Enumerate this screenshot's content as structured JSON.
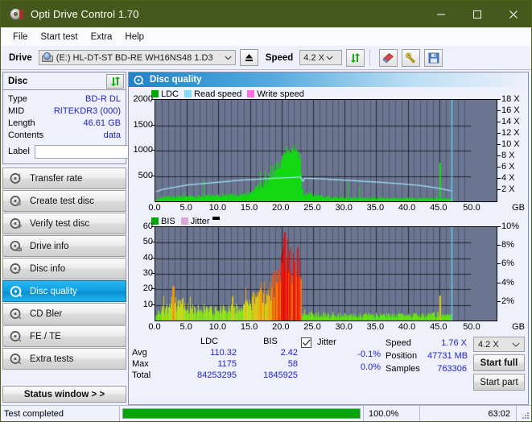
{
  "window": {
    "title": "Opti Drive Control 1.70",
    "icon": "disc-icon",
    "minimize": "–",
    "maximize": "□",
    "close": "✕"
  },
  "menu": {
    "items": [
      {
        "label": "File"
      },
      {
        "label": "Start test"
      },
      {
        "label": "Extra"
      },
      {
        "label": "Help"
      }
    ]
  },
  "toolbar": {
    "drive_label": "Drive",
    "drive_value": "(E:)  HL-DT-ST BD-RE  WH16NS48 1.D3",
    "eject_title": "eject-button",
    "speed_label": "Speed",
    "speed_value": "4.2 X",
    "refresh_title": "refresh-button",
    "erase_title": "erase-button",
    "tools_title": "tools-button",
    "save_title": "save-button"
  },
  "disc_panel": {
    "title": "Disc",
    "refresh_title": "refresh-disc-button",
    "rows": [
      {
        "key": "Type",
        "value": "BD-R DL"
      },
      {
        "key": "MID",
        "value": "RITEKDR3 (000)"
      },
      {
        "key": "Length",
        "value": "46.61 GB"
      },
      {
        "key": "Contents",
        "value": "data"
      }
    ],
    "label_key": "Label",
    "label_value": "",
    "label_placeholder": ""
  },
  "sidebar": {
    "items": [
      {
        "label": "Transfer rate",
        "icon": "disc-test-icon",
        "active": false
      },
      {
        "label": "Create test disc",
        "icon": "disc-burn-icon",
        "active": false
      },
      {
        "label": "Verify test disc",
        "icon": "disc-verify-icon",
        "active": false
      },
      {
        "label": "Drive info",
        "icon": "drive-info-icon",
        "active": false
      },
      {
        "label": "Disc info",
        "icon": "disc-info-icon",
        "active": false
      },
      {
        "label": "Disc quality",
        "icon": "disc-quality-icon",
        "active": true
      },
      {
        "label": "CD Bler",
        "icon": "cd-bler-icon",
        "active": false
      },
      {
        "label": "FE / TE",
        "icon": "fe-te-icon",
        "active": false
      },
      {
        "label": "Extra tests",
        "icon": "extra-tests-icon",
        "active": false
      }
    ],
    "status_button": "Status window > >"
  },
  "panel": {
    "title": "Disc quality",
    "icon": "disc-quality-icon"
  },
  "chart_data": [
    {
      "id": "ldc-chart",
      "type": "area",
      "title": "",
      "xlabel": "GB",
      "ylabel": "",
      "xlim": [
        0,
        50
      ],
      "ylim": [
        0,
        2000
      ],
      "y2lim": [
        0,
        18
      ],
      "y2label": "X",
      "xticks": [
        0.0,
        5.0,
        10.0,
        15.0,
        20.0,
        25.0,
        30.0,
        35.0,
        40.0,
        45.0,
        50.0
      ],
      "xticklabels": [
        "0.0",
        "5.0",
        "10.0",
        "15.0",
        "20.0",
        "25.0",
        "30.0",
        "35.0",
        "40.0",
        "45.0",
        "50.0"
      ],
      "yticks": [
        500,
        1000,
        1500,
        2000
      ],
      "yticklabels": [
        "500",
        "1000",
        "1500",
        "2000"
      ],
      "y2ticks": [
        2,
        4,
        6,
        8,
        10,
        12,
        14,
        16,
        18
      ],
      "y2ticklabels": [
        "2 X",
        "4 X",
        "6 X",
        "8 X",
        "10 X",
        "12 X",
        "14 X",
        "16 X",
        "18 X"
      ],
      "grid": true,
      "plot_bg": "#6b7590",
      "legend": [
        {
          "label": "LDC",
          "color": "#00a800"
        },
        {
          "label": "Read speed",
          "color": "#8ad8f5"
        },
        {
          "label": "Write speed",
          "color": "#ff6ee0"
        }
      ],
      "series": [
        {
          "name": "LDC",
          "color": "#12d812",
          "kind": "spikes",
          "x_end": 46.9,
          "baseline": [
            [
              0.0,
              40
            ],
            [
              1.0,
              95
            ],
            [
              2.0,
              110
            ],
            [
              3.0,
              120
            ],
            [
              4.0,
              115
            ],
            [
              5.0,
              118
            ],
            [
              6.0,
              120
            ],
            [
              7.0,
              122
            ],
            [
              8.0,
              125
            ],
            [
              9.0,
              128
            ],
            [
              10.0,
              130
            ],
            [
              11.0,
              135
            ],
            [
              12.0,
              140
            ],
            [
              13.0,
              150
            ],
            [
              14.0,
              165
            ],
            [
              15.0,
              200
            ],
            [
              16.0,
              290
            ],
            [
              17.0,
              430
            ],
            [
              18.0,
              570
            ],
            [
              19.0,
              720
            ],
            [
              20.0,
              900
            ],
            [
              20.8,
              1060
            ],
            [
              21.3,
              1020
            ],
            [
              21.8,
              1040
            ],
            [
              22.3,
              990
            ],
            [
              22.7,
              930
            ],
            [
              23.0,
              870
            ],
            [
              23.2,
              260
            ],
            [
              23.5,
              180
            ],
            [
              24.0,
              180
            ],
            [
              25.0,
              150
            ],
            [
              26.0,
              120
            ],
            [
              28.0,
              95
            ],
            [
              30.0,
              80
            ],
            [
              33.0,
              75
            ],
            [
              36.0,
              75
            ],
            [
              40.0,
              70
            ],
            [
              43.0,
              68
            ],
            [
              45.0,
              70
            ],
            [
              46.5,
              65
            ],
            [
              46.9,
              60
            ]
          ],
          "peak_max": 1175
        },
        {
          "name": "Read speed",
          "color": "#9fe0f7",
          "kind": "line",
          "axis": "y2",
          "points": [
            [
              0.0,
              1.7
            ],
            [
              1.0,
              2.1
            ],
            [
              2.0,
              2.3
            ],
            [
              3.0,
              2.5
            ],
            [
              4.0,
              2.7
            ],
            [
              5.0,
              2.9
            ],
            [
              6.0,
              3.0
            ],
            [
              7.0,
              3.1
            ],
            [
              8.0,
              3.2
            ],
            [
              9.0,
              3.3
            ],
            [
              10.0,
              3.4
            ],
            [
              11.0,
              3.5
            ],
            [
              12.0,
              3.6
            ],
            [
              13.0,
              3.7
            ],
            [
              14.0,
              3.8
            ],
            [
              15.0,
              3.85
            ],
            [
              16.0,
              3.9
            ],
            [
              17.0,
              4.0
            ],
            [
              18.0,
              4.05
            ],
            [
              19.0,
              4.1
            ],
            [
              20.0,
              4.15
            ],
            [
              21.0,
              4.2
            ],
            [
              22.0,
              4.25
            ],
            [
              23.0,
              4.3
            ],
            [
              23.3,
              3.5
            ],
            [
              23.6,
              4.1
            ],
            [
              25.0,
              4.05
            ],
            [
              27.0,
              3.95
            ],
            [
              30.0,
              3.75
            ],
            [
              33.0,
              3.55
            ],
            [
              36.0,
              3.35
            ],
            [
              39.0,
              3.1
            ],
            [
              42.0,
              2.8
            ],
            [
              45.0,
              2.3
            ],
            [
              46.6,
              1.9
            ],
            [
              46.9,
              1.85
            ]
          ]
        },
        {
          "name": "Write speed",
          "color": "#ff6ee0",
          "kind": "line",
          "points": []
        }
      ],
      "cursor_x": 46.95,
      "cursor_color": "#5fd4f5"
    },
    {
      "id": "bis-chart",
      "type": "area",
      "title": "",
      "xlabel": "GB",
      "ylabel": "",
      "xlim": [
        0,
        50
      ],
      "ylim": [
        0,
        60
      ],
      "y2lim": [
        0,
        10
      ],
      "y2label": "%",
      "xticks": [
        0.0,
        5.0,
        10.0,
        15.0,
        20.0,
        25.0,
        30.0,
        35.0,
        40.0,
        45.0,
        50.0
      ],
      "xticklabels": [
        "0.0",
        "5.0",
        "10.0",
        "15.0",
        "20.0",
        "25.0",
        "30.0",
        "35.0",
        "40.0",
        "45.0",
        "50.0"
      ],
      "yticks": [
        10,
        20,
        30,
        40,
        50,
        60
      ],
      "yticklabels": [
        "10",
        "20",
        "30",
        "40",
        "50",
        "60"
      ],
      "y2ticks": [
        2,
        4,
        6,
        8,
        10
      ],
      "y2ticklabels": [
        "2%",
        "4%",
        "6%",
        "8%",
        "10%"
      ],
      "grid": true,
      "plot_bg": "#6b7590",
      "legend": [
        {
          "label": "BIS",
          "color": "#00a800"
        },
        {
          "label": "Jitter",
          "color": "#d8a8d8"
        }
      ],
      "series": [
        {
          "name": "BIS",
          "kind": "spikes-colored",
          "x_end": 46.9,
          "baseline": [
            [
              0.0,
              3
            ],
            [
              0.5,
              6
            ],
            [
              1.0,
              8
            ],
            [
              2.0,
              10
            ],
            [
              2.8,
              14
            ],
            [
              3.5,
              11
            ],
            [
              4.5,
              12
            ],
            [
              5.5,
              10
            ],
            [
              7.0,
              9
            ],
            [
              9.0,
              8
            ],
            [
              11.0,
              9
            ],
            [
              12.5,
              10
            ],
            [
              14.0,
              10
            ],
            [
              15.0,
              13
            ],
            [
              15.5,
              15
            ],
            [
              16.0,
              17
            ],
            [
              17.0,
              20
            ],
            [
              18.0,
              24
            ],
            [
              19.0,
              27
            ],
            [
              20.0,
              38
            ],
            [
              20.5,
              48
            ],
            [
              21.0,
              42
            ],
            [
              21.5,
              36
            ],
            [
              22.0,
              34
            ],
            [
              22.5,
              38
            ],
            [
              23.0,
              40
            ],
            [
              23.2,
              6
            ],
            [
              24.0,
              5
            ],
            [
              26.0,
              5
            ],
            [
              28.0,
              4
            ],
            [
              30.0,
              4
            ],
            [
              33.0,
              4
            ],
            [
              36.0,
              4
            ],
            [
              40.0,
              4
            ],
            [
              43.0,
              4
            ],
            [
              45.0,
              5
            ],
            [
              46.9,
              4
            ]
          ],
          "peak_max": 58,
          "color_ramp": [
            {
              "v": 0,
              "color": "#33d926"
            },
            {
              "v": 12,
              "color": "#c8e21a"
            },
            {
              "v": 20,
              "color": "#f2a812"
            },
            {
              "v": 30,
              "color": "#ef5a0c"
            },
            {
              "v": 40,
              "color": "#e41010"
            }
          ]
        },
        {
          "name": "Jitter",
          "kind": "line",
          "color": "#d8a8d8",
          "points": []
        }
      ],
      "cursor_x": 46.95,
      "cursor_color": "#5fd4f5"
    }
  ],
  "stats": {
    "headers": [
      "",
      "LDC",
      "BIS"
    ],
    "rows": [
      {
        "key": "Avg",
        "ldc": "110.32",
        "bis": "2.42"
      },
      {
        "key": "Max",
        "ldc": "1175",
        "bis": "58"
      },
      {
        "key": "Total",
        "ldc": "84253295",
        "bis": "1845925"
      }
    ],
    "jitter": {
      "checked": true,
      "label": "Jitter",
      "avg": "-0.1%",
      "max": "0.0%"
    },
    "speed_key": "Speed",
    "speed_value": "1.76 X",
    "position_key": "Position",
    "position_value": "47731 MB",
    "samples_key": "Samples",
    "samples_value": "763306",
    "speed_select": "4.2 X",
    "start_full": "Start full",
    "start_part": "Start part"
  },
  "statusbar": {
    "message": "Test completed",
    "progress_percent": 100.0,
    "progress_text": "100.0%",
    "elapsed": "63:02",
    "progress_color": "#07a307"
  }
}
